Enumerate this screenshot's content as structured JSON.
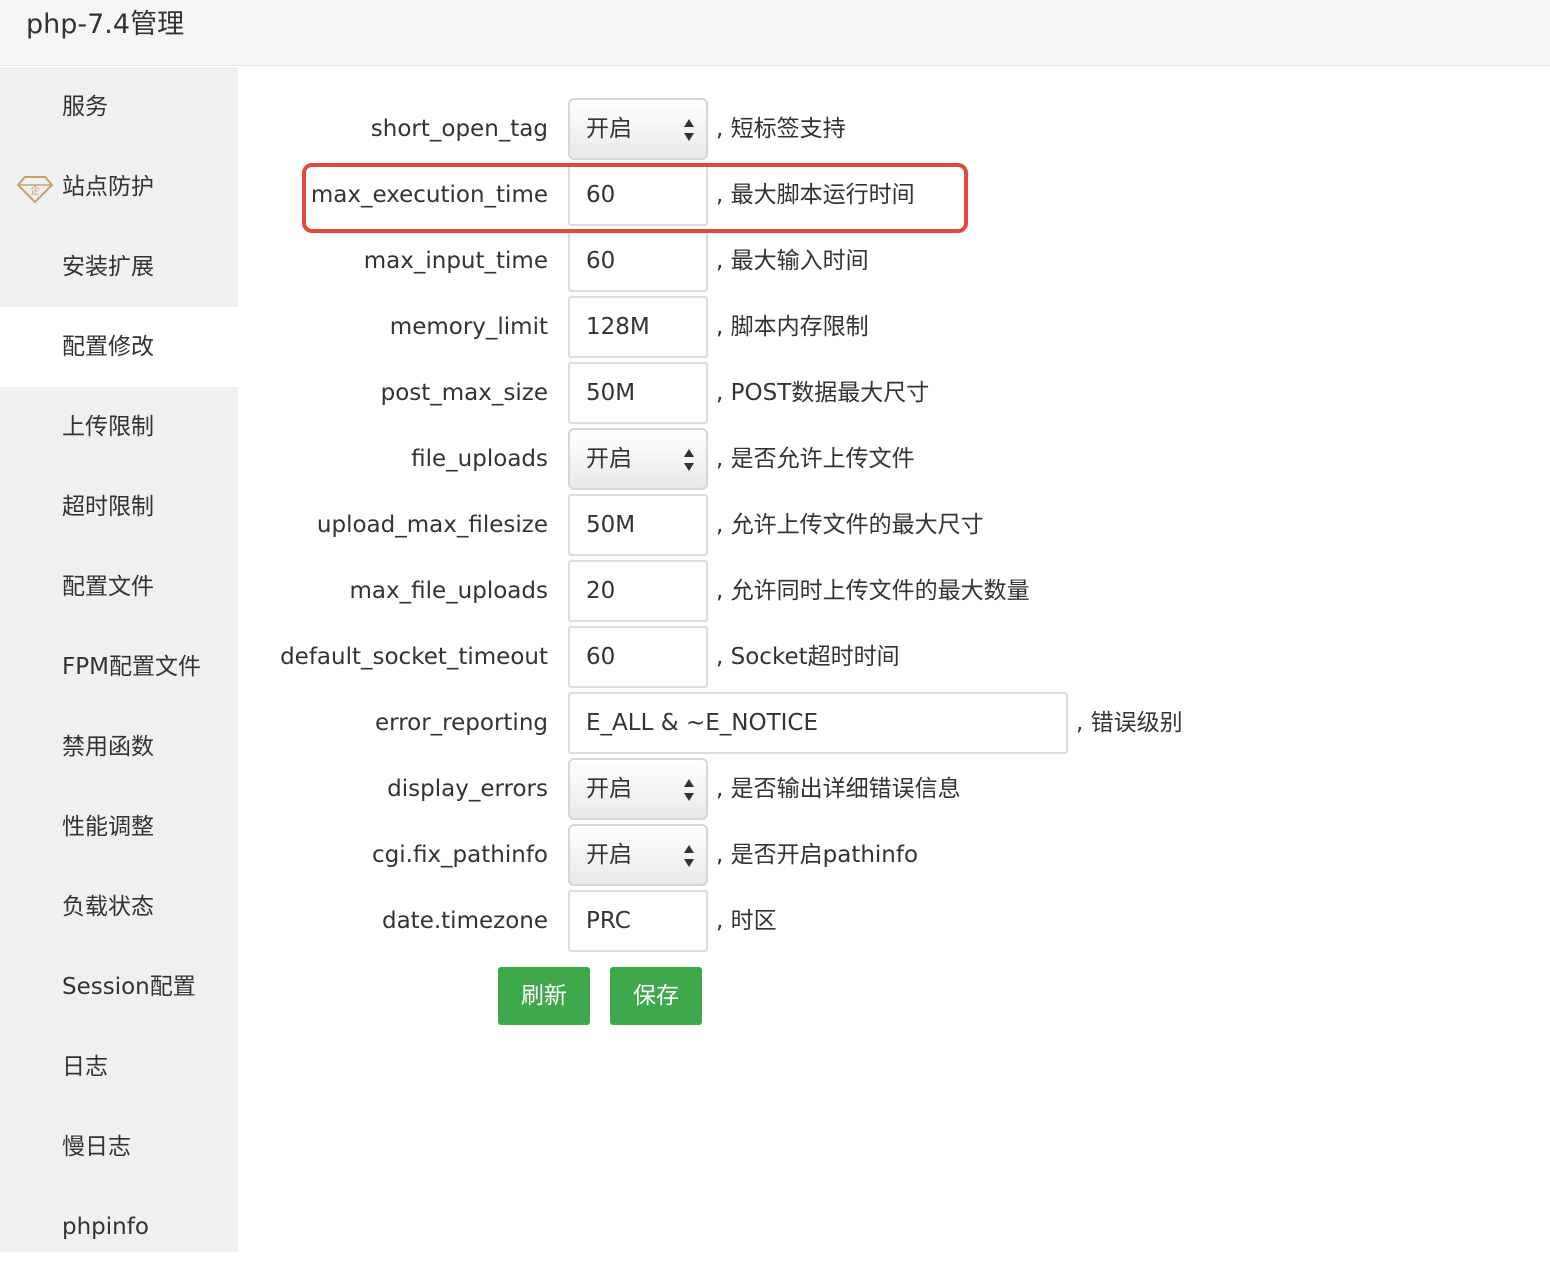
{
  "window": {
    "title": "php-7.4管理"
  },
  "sidebar": {
    "items": [
      {
        "label": "服务",
        "active": false
      },
      {
        "label": "站点防护",
        "active": false,
        "icon": "gem-icon",
        "icon_color": "#c4a36a"
      },
      {
        "label": "安装扩展",
        "active": false
      },
      {
        "label": "配置修改",
        "active": true
      },
      {
        "label": "上传限制",
        "active": false
      },
      {
        "label": "超时限制",
        "active": false
      },
      {
        "label": "配置文件",
        "active": false
      },
      {
        "label": "FPM配置文件",
        "active": false
      },
      {
        "label": "禁用函数",
        "active": false
      },
      {
        "label": "性能调整",
        "active": false
      },
      {
        "label": "负载状态",
        "active": false
      },
      {
        "label": "Session配置",
        "active": false
      },
      {
        "label": "日志",
        "active": false
      },
      {
        "label": "慢日志",
        "active": false
      },
      {
        "label": "phpinfo",
        "active": false
      }
    ]
  },
  "config": {
    "rows": [
      {
        "label": "short_open_tag",
        "type": "select",
        "value": "开启",
        "desc": ", 短标签支持"
      },
      {
        "label": "max_execution_time",
        "type": "input",
        "value": "60",
        "desc": ", 最大脚本运行时间",
        "highlighted": true
      },
      {
        "label": "max_input_time",
        "type": "input",
        "value": "60",
        "desc": ", 最大输入时间"
      },
      {
        "label": "memory_limit",
        "type": "input",
        "value": "128M",
        "desc": ", 脚本内存限制"
      },
      {
        "label": "post_max_size",
        "type": "input",
        "value": "50M",
        "desc": ", POST数据最大尺寸"
      },
      {
        "label": "file_uploads",
        "type": "select",
        "value": "开启",
        "desc": ", 是否允许上传文件"
      },
      {
        "label": "upload_max_filesize",
        "type": "input",
        "value": "50M",
        "desc": ", 允许上传文件的最大尺寸"
      },
      {
        "label": "max_file_uploads",
        "type": "input",
        "value": "20",
        "desc": ", 允许同时上传文件的最大数量"
      },
      {
        "label": "default_socket_timeout",
        "type": "input",
        "value": "60",
        "desc": ", Socket超时时间"
      },
      {
        "label": "error_reporting",
        "type": "input",
        "value": "E_ALL & ~E_NOTICE",
        "desc": ", 错误级别"
      },
      {
        "label": "display_errors",
        "type": "select",
        "value": "开启",
        "desc": ", 是否输出详细错误信息"
      },
      {
        "label": "cgi.fix_pathinfo",
        "type": "select",
        "value": "开启",
        "desc": ", 是否开启pathinfo"
      },
      {
        "label": "date.timezone",
        "type": "input",
        "value": "PRC",
        "desc": ", 时区"
      }
    ]
  },
  "buttons": {
    "refresh_label": "刷新",
    "save_label": "保存"
  },
  "colors": {
    "accent_green": "#3fa84a",
    "highlight_red": "#e04a3a",
    "sidebar_bg": "#f0f0f0"
  }
}
